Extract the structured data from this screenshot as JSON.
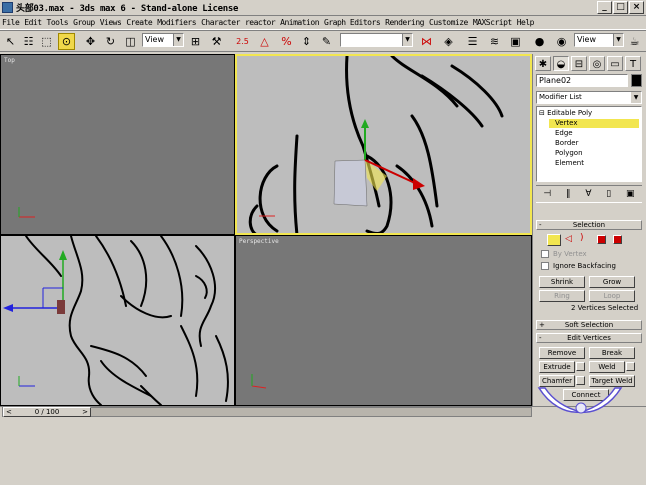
{
  "window": {
    "title": "头部03.max - 3ds max 6 - Stand-alone License",
    "buttons": [
      "_",
      "□",
      "×"
    ]
  },
  "menu": [
    "File",
    "Edit",
    "Tools",
    "Group",
    "Views",
    "Create",
    "Modifiers",
    "Character",
    "reactor",
    "Animation",
    "Graph Editors",
    "Rendering",
    "Customize",
    "MAXScript",
    "Help"
  ],
  "toolbar": {
    "view_dropdown_1": "View",
    "selection_set": "",
    "view_dropdown_2": "View",
    "snap_angle_label": "2.5"
  },
  "viewports": {
    "top": {
      "label": "Top"
    },
    "front": {
      "label": ""
    },
    "left": {
      "label": ""
    },
    "perspective": {
      "label": "Perspective"
    }
  },
  "command_panel": {
    "object_name": "Plane02",
    "object_color": "#000000",
    "modifier_list": "Modifier List",
    "stack": {
      "root": "Editable Poly",
      "items": [
        "Vertex",
        "Edge",
        "Border",
        "Polygon",
        "Element"
      ],
      "selected": "Vertex"
    },
    "selection": {
      "title": "Selection",
      "by_vertex": "By Vertex",
      "ignore_backfacing": "Ignore Backfacing",
      "shrink": "Shrink",
      "grow": "Grow",
      "ring": "Ring",
      "loop": "Loop",
      "status": "2 Vertices Selected"
    },
    "soft_selection": {
      "title": "Soft Selection"
    },
    "edit_vertices": {
      "title": "Edit Vertices",
      "remove": "Remove",
      "break": "Break",
      "extrude": "Extrude",
      "weld": "Weld",
      "chamfer": "Chamfer",
      "target_weld": "Target Weld",
      "connect": "Connect"
    }
  },
  "timeline": {
    "frame": "0 / 100"
  },
  "colors": {
    "active_viewport_border": "#f2e650",
    "selection_highlight": "#f2e650",
    "viewport_gray": "#bdbdbd",
    "viewport_dark": "#777777"
  }
}
